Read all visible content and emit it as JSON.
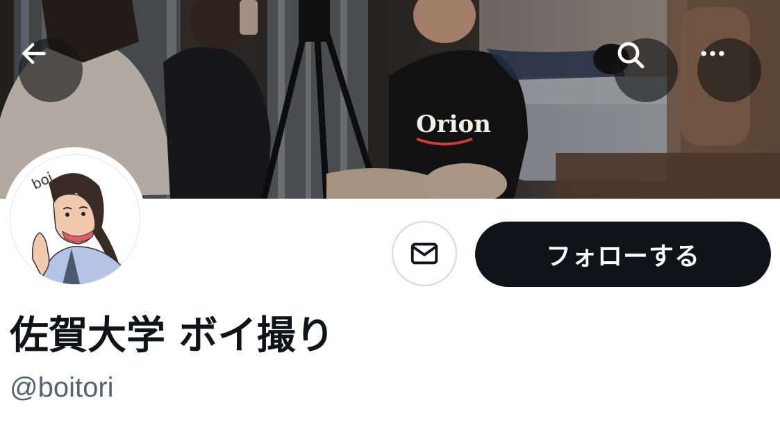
{
  "header": {
    "back_label": "Back",
    "search_label": "Search",
    "more_label": "More"
  },
  "banner": {
    "shirt_text": "Orion"
  },
  "avatar": {
    "sketch_text": "boi"
  },
  "profile": {
    "display_name": "佐賀大学 ボイ撮り",
    "handle": "@boitori",
    "follow_label": "フォローする"
  },
  "icons": {
    "back": "arrow-left-icon",
    "search": "search-icon",
    "more": "more-horizontal-icon",
    "message": "envelope-icon"
  },
  "colors": {
    "primary_text": "#0f1419",
    "secondary_text": "#536471",
    "follow_button_bg": "#0f1419",
    "follow_button_text": "#ffffff",
    "message_border": "#cfd9de"
  }
}
